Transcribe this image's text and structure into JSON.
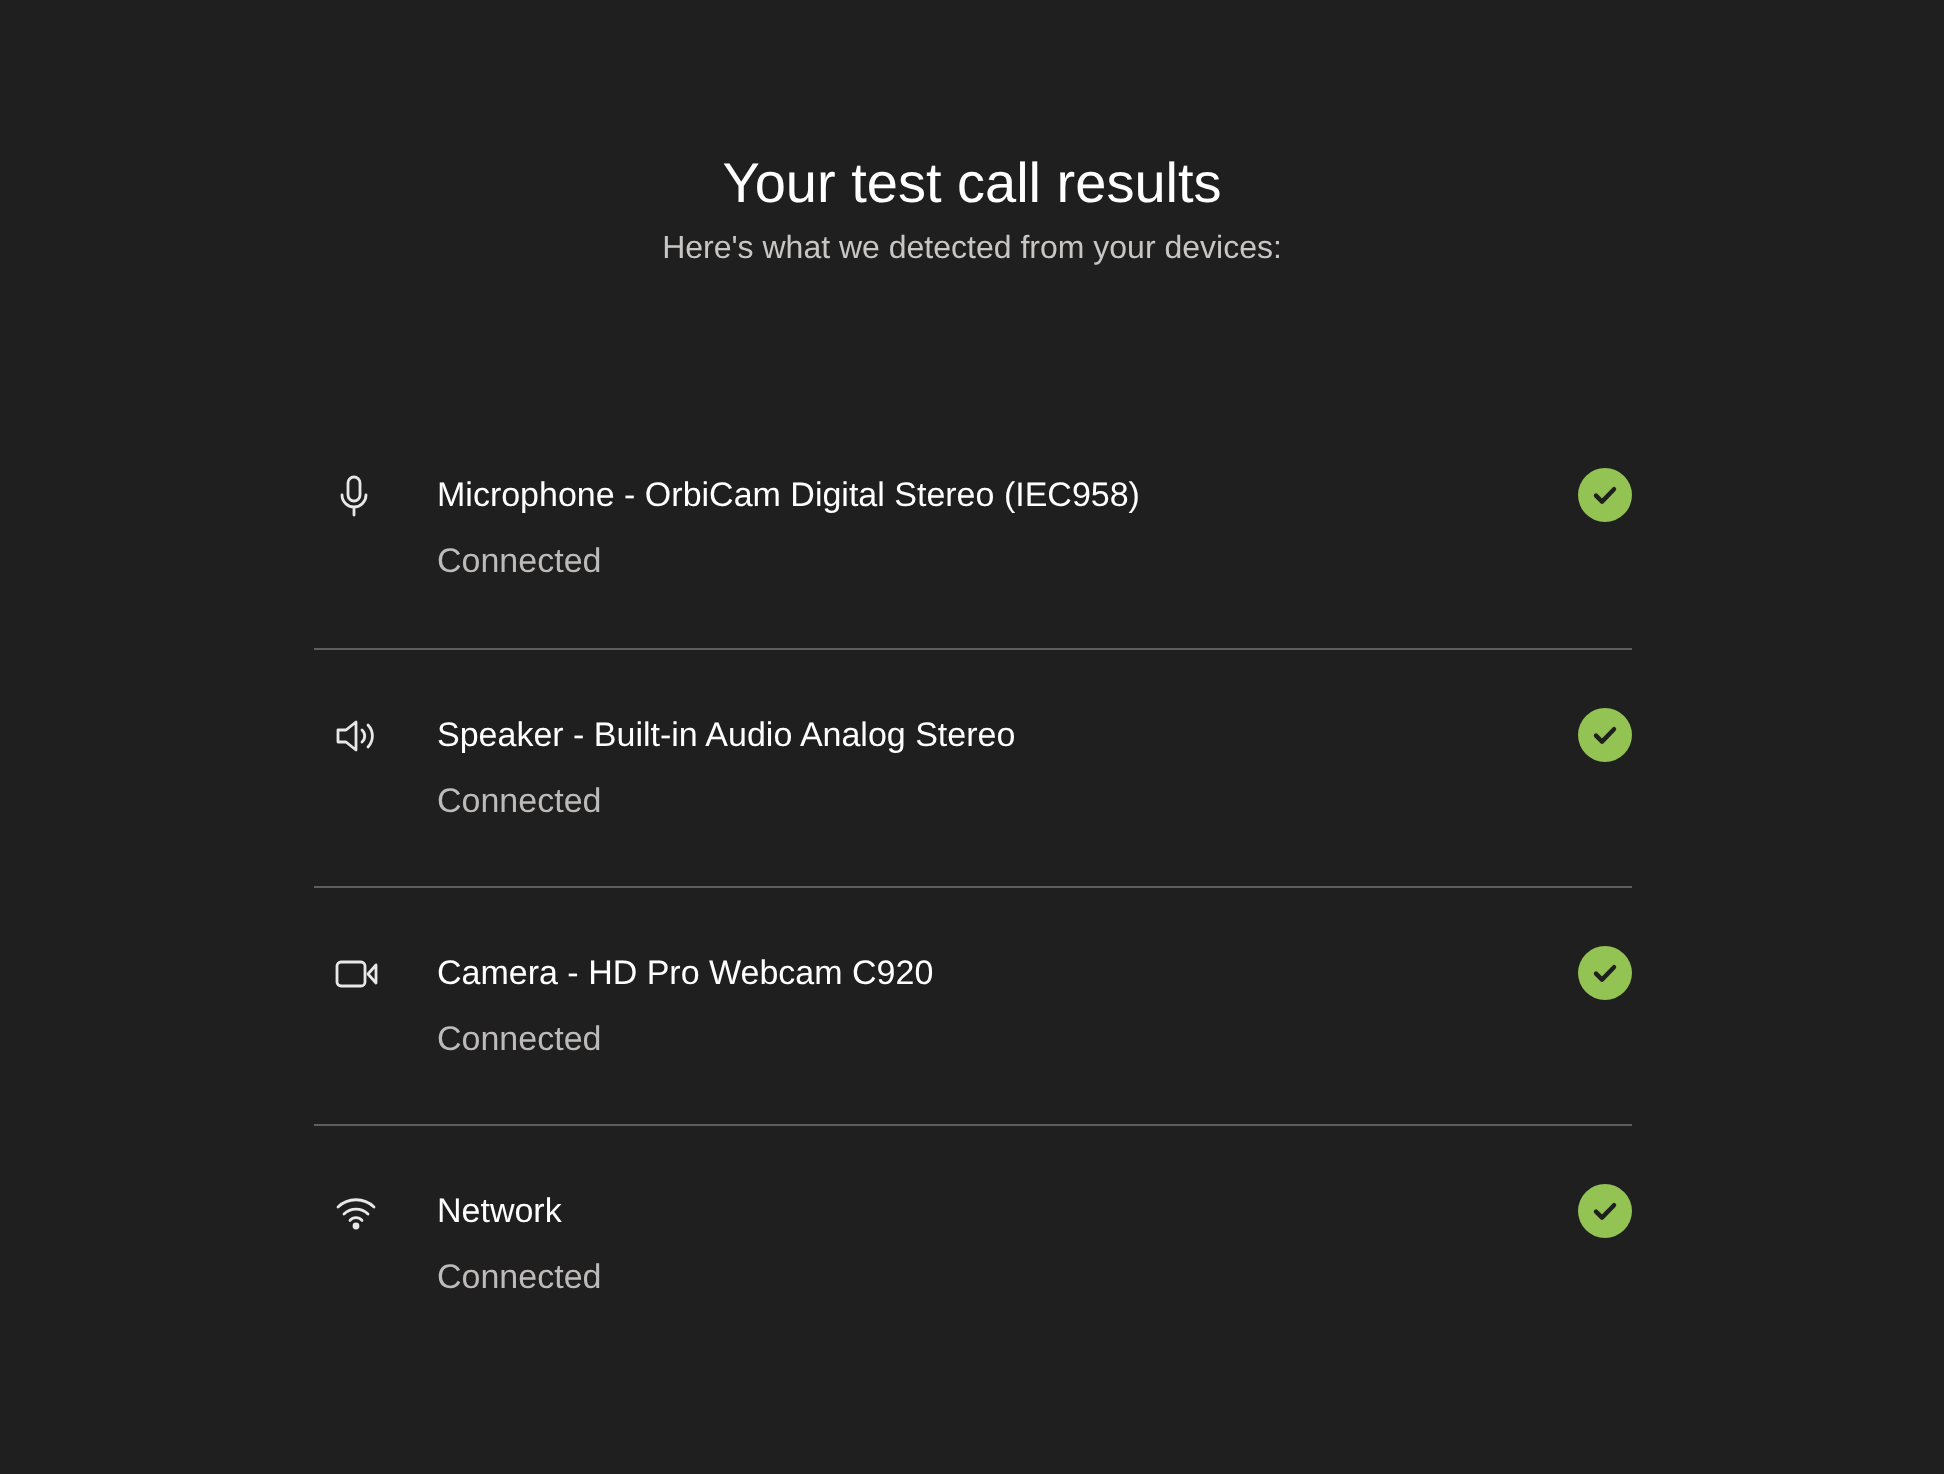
{
  "title": "Your test call results",
  "subtitle": "Here's what we detected from your devices:",
  "devices": [
    {
      "kind": "microphone",
      "name": "Microphone - OrbiCam Digital Stereo (IEC958)",
      "status": "Connected",
      "passed": true
    },
    {
      "kind": "speaker",
      "name": "Speaker - Built-in Audio Analog Stereo",
      "status": "Connected",
      "passed": true
    },
    {
      "kind": "camera",
      "name": "Camera - HD Pro Webcam C920",
      "status": "Connected",
      "passed": true
    },
    {
      "kind": "network",
      "name": "Network",
      "status": "Connected",
      "passed": true
    }
  ]
}
